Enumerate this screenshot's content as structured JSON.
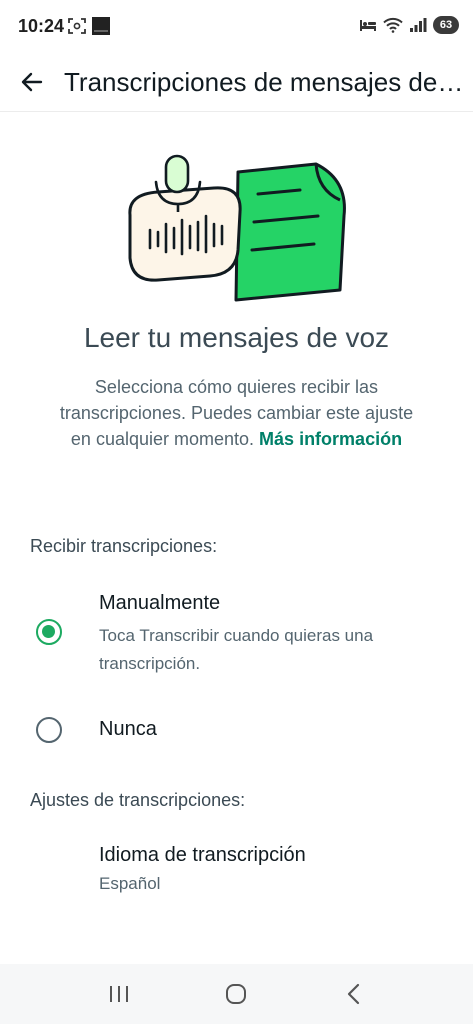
{
  "status_bar": {
    "time": "10:24",
    "battery": "63",
    "left_icons": [
      "screenshot-icon",
      "orange-app-icon"
    ],
    "right_icons": [
      "bed-icon",
      "wifi-icon",
      "signal-icon",
      "battery-icon"
    ]
  },
  "app_bar": {
    "title": "Transcripciones de mensajes de voz",
    "back_icon": "arrow-back-icon"
  },
  "intro": {
    "heading": "Leer tu mensajes de voz",
    "description": "Selecciona cómo quieres recibir las transcripciones. Puedes cambiar este ajuste en cualquier momento.",
    "link": "Más información"
  },
  "receive_section": {
    "label": "Recibir transcripciones:",
    "options": [
      {
        "title": "Manualmente",
        "subtitle": "Toca Transcribir cuando quieras una transcripción.",
        "selected": true
      },
      {
        "title": "Nunca",
        "subtitle": "",
        "selected": false
      }
    ]
  },
  "settings_section": {
    "label": "Ajustes de transcripciones:",
    "language_title": "Idioma de transcripción",
    "language_value": "Español"
  },
  "colors": {
    "accent": "#1daa61",
    "link": "#008069",
    "primary_text": "#111b21",
    "secondary_text": "#54656f"
  },
  "nav_bar": [
    "recents-icon",
    "home-icon",
    "back-icon"
  ]
}
